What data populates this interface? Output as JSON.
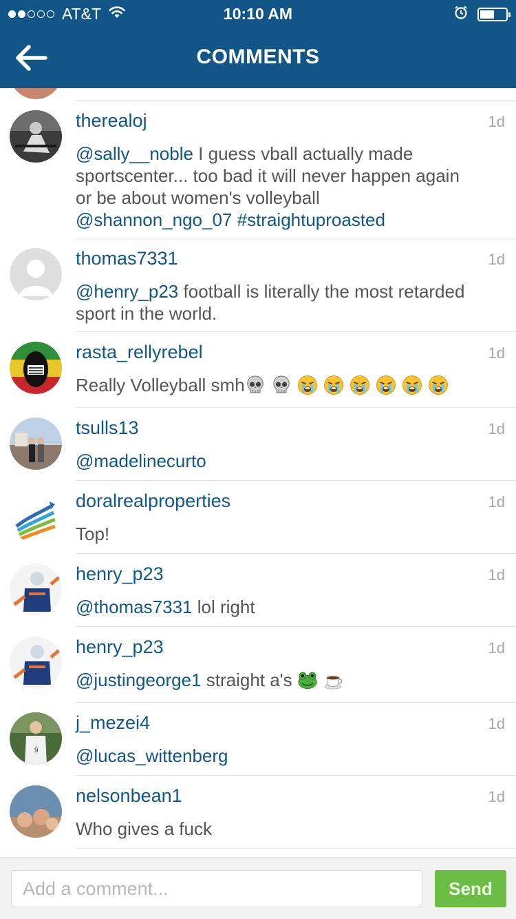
{
  "status_bar": {
    "carrier": "AT&T",
    "time": "10:10 AM",
    "signal_bars_filled": 2,
    "signal_bars_total": 5,
    "battery_level": 0.55
  },
  "nav": {
    "title": "COMMENTS",
    "back_icon": "arrow-left-icon"
  },
  "comments": [
    {
      "username": "therealoj",
      "age": "1d",
      "parts": [
        {
          "t": "@sally__noble",
          "m": true
        },
        {
          "t": " I guess vball actually made sportscenter... too bad it will never happen again or be about women's volleyball ",
          "m": false
        },
        {
          "t": "@shannon_ngo_07",
          "m": true
        },
        {
          "t": " ",
          "m": false
        },
        {
          "t": "#straightuproasted",
          "m": true
        }
      ]
    },
    {
      "username": "thomas7331",
      "age": "1d",
      "parts": [
        {
          "t": "@henry_p23",
          "m": true
        },
        {
          "t": " football is literally the most retarded sport in the world.",
          "m": false
        }
      ]
    },
    {
      "username": "rasta_rellyrebel",
      "age": "1d",
      "parts": [
        {
          "t": "Really Volleyball smh",
          "m": false
        }
      ],
      "emojis": [
        "skull-emoji",
        "skull-emoji",
        "crying-face-emoji",
        "crying-face-emoji",
        "crying-face-emoji",
        "crying-face-emoji",
        "crying-face-emoji",
        "crying-face-emoji"
      ]
    },
    {
      "username": "tsulls13",
      "age": "1d",
      "parts": [
        {
          "t": "@madelinecurto",
          "m": true
        }
      ]
    },
    {
      "username": "doralrealproperties",
      "age": "1d",
      "parts": [
        {
          "t": "Top!",
          "m": false
        }
      ]
    },
    {
      "username": "henry_p23",
      "age": "1d",
      "parts": [
        {
          "t": "@thomas7331",
          "m": true
        },
        {
          "t": " lol right",
          "m": false
        }
      ]
    },
    {
      "username": "henry_p23",
      "age": "1d",
      "parts": [
        {
          "t": "@justingeorge1",
          "m": true
        },
        {
          "t": " straight a's ",
          "m": false
        }
      ],
      "emojis": [
        "frog-emoji",
        "coffee-emoji"
      ]
    },
    {
      "username": "j_mezei4",
      "age": "1d",
      "parts": [
        {
          "t": "@lucas_wittenberg",
          "m": true
        }
      ]
    },
    {
      "username": "nelsonbean1",
      "age": "1d",
      "parts": [
        {
          "t": "Who gives a fuck",
          "m": false
        }
      ]
    }
  ],
  "footer": {
    "placeholder": "Add a comment...",
    "send_label": "Send"
  },
  "colors": {
    "header_bg": "#125688",
    "link": "#125688",
    "send_button": "#6cbd45"
  }
}
